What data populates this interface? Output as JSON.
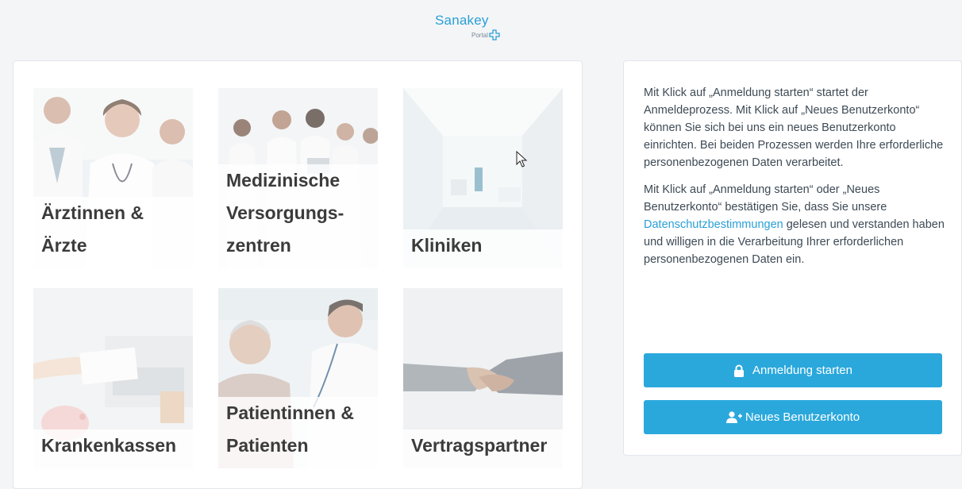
{
  "header": {
    "logo_name": "Sanakey",
    "logo_sub": "Portal"
  },
  "tiles": [
    {
      "label": "Ärztinnen &\nÄrzte"
    },
    {
      "label": "Medizinische\nVersorgungs-\nzentren"
    },
    {
      "label": "Kliniken"
    },
    {
      "label": "Krankenkassen"
    },
    {
      "label": "Patientinnen &\nPatienten"
    },
    {
      "label": "Vertragspartner"
    }
  ],
  "info": {
    "paragraph1": "Mit Klick auf „Anmeldung starten“ startet der Anmeldeprozess. Mit Klick auf „Neues Benutzerkonto“ können Sie sich bei uns ein neues Benutzerkonto einrichten. Bei beiden Prozessen werden Ihre erforderliche personenbezogenen Daten verarbeitet.",
    "paragraph2_before": "Mit Klick auf „Anmeldung starten“ oder „Neues Benutzerkonto“ bestätigen Sie, dass Sie unsere ",
    "paragraph2_link": "Datenschutzbestimmungen",
    "paragraph2_after": " gelesen und verstanden haben und willigen in die Verarbeitung Ihrer erforderlichen personenbezogenen Daten ein."
  },
  "buttons": {
    "login": "Anmeldung starten",
    "register": "Neues Benutzerkonto"
  },
  "colors": {
    "brand": "#2a9fd6",
    "button": "#2aa8dc"
  }
}
